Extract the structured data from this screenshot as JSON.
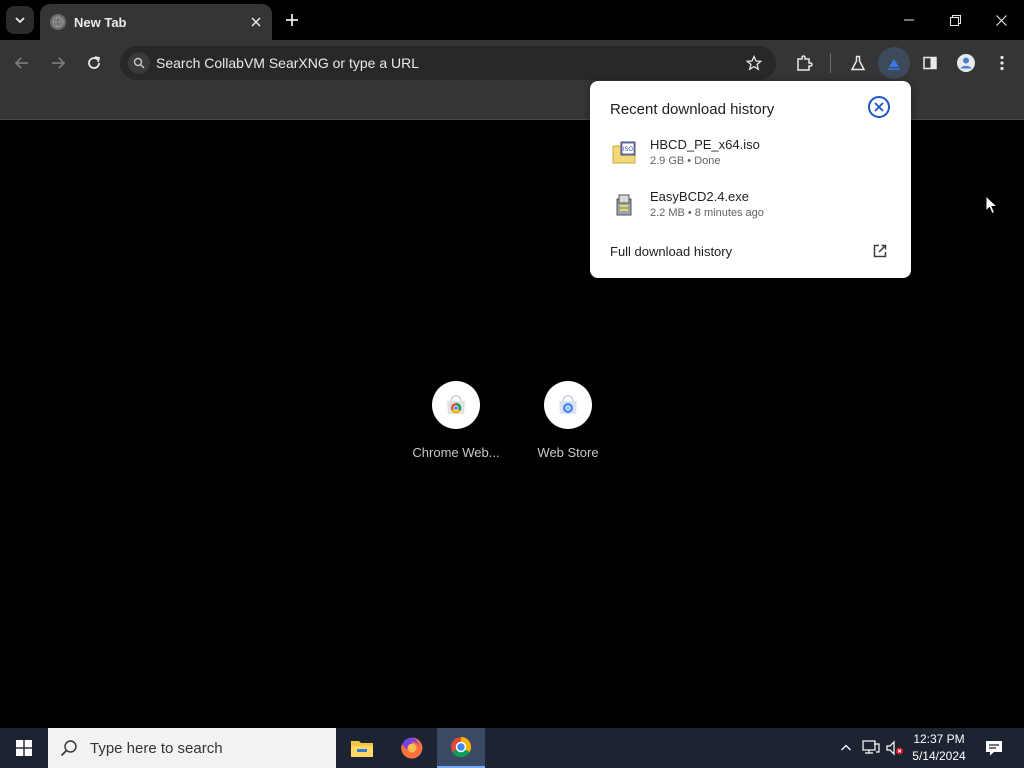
{
  "browser": {
    "tab": {
      "title": "New Tab"
    },
    "omnibox": {
      "placeholder": "Search CollabVM SearXNG or type a URL"
    }
  },
  "shortcuts": [
    {
      "label": "Chrome Web..."
    },
    {
      "label": "Web Store"
    }
  ],
  "downloads": {
    "title": "Recent download history",
    "items": [
      {
        "name": "HBCD_PE_x64.iso",
        "meta": "2.9 GB • Done",
        "icon": "iso-file-icon",
        "icon_text": "ISO"
      },
      {
        "name": "EasyBCD2.4.exe",
        "meta": "2.2 MB • 8 minutes ago",
        "icon": "installer-file-icon"
      }
    ],
    "full_history_label": "Full download history"
  },
  "taskbar": {
    "search_placeholder": "Type here to search",
    "clock_time": "12:37 PM",
    "clock_date": "5/14/2024"
  },
  "colors": {
    "accent": "#1a56c4",
    "toolbar_bg": "#353535",
    "taskbar_bg": "#1c2331"
  }
}
